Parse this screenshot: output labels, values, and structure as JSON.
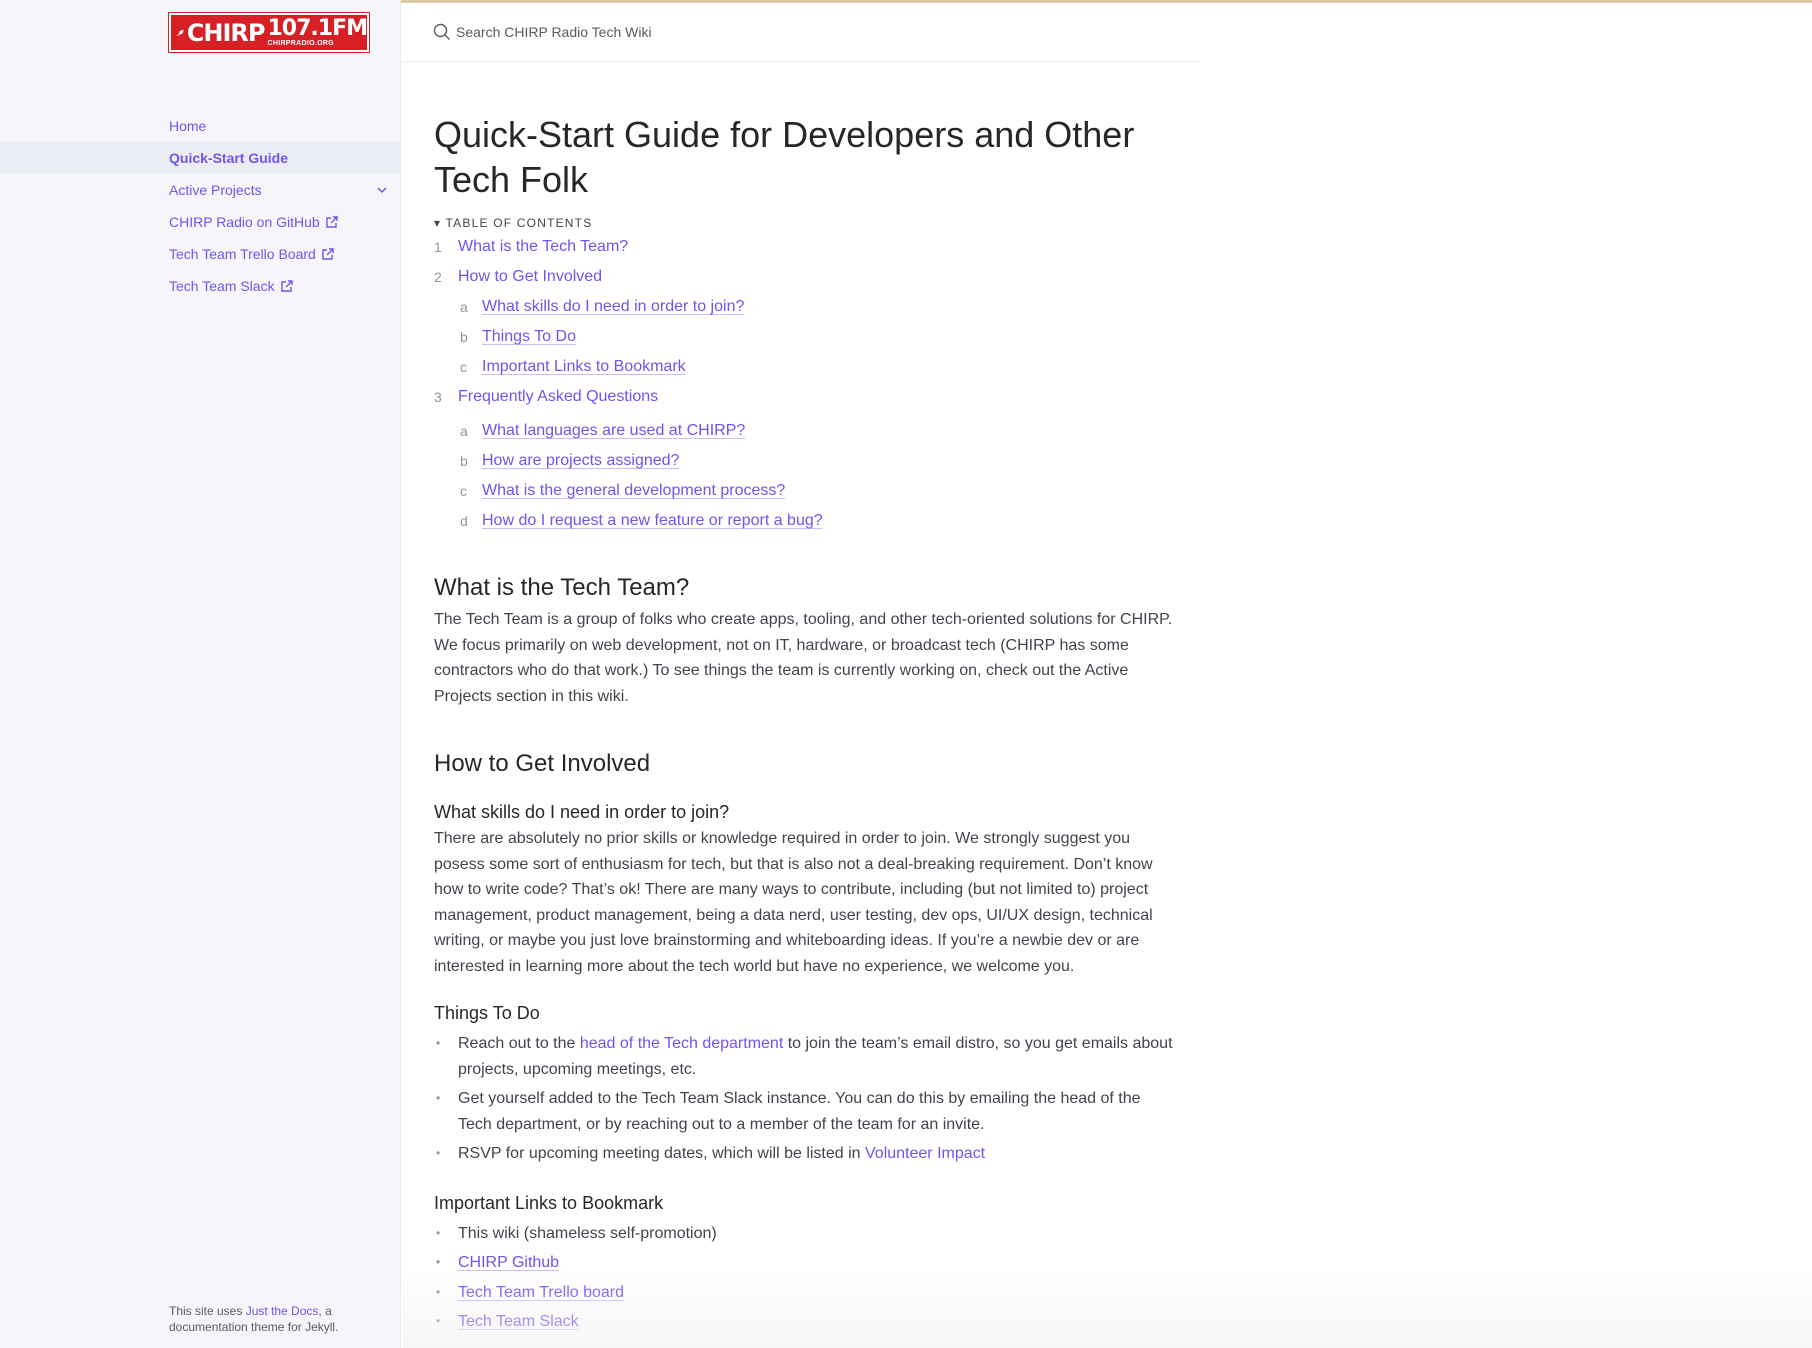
{
  "logo": {
    "name": "CHIRP",
    "frequency": "107.1FM",
    "url": "CHIRPRADIO.ORG"
  },
  "search": {
    "placeholder": "Search CHIRP Radio Tech Wiki"
  },
  "sidebar": {
    "items": [
      {
        "label": "Home"
      },
      {
        "label": "Quick-Start Guide",
        "active": true
      },
      {
        "label": "Active Projects"
      },
      {
        "label": "CHIRP Radio on GitHub"
      },
      {
        "label": "Tech Team Trello Board"
      },
      {
        "label": "Tech Team Slack"
      }
    ],
    "footer": {
      "prefix": "This site uses ",
      "link": "Just the Docs",
      "suffix": ", a documentation theme for Jekyll."
    }
  },
  "page": {
    "title": "Quick-Start Guide for Developers and Other Tech Folk",
    "toc_label": "▾ Table of contents",
    "toc": [
      {
        "num": "1",
        "label": "What is the Tech Team?"
      },
      {
        "num": "2",
        "label": "How to Get Involved",
        "children": [
          {
            "num": "a",
            "label": "What skills do I need in order to join?"
          },
          {
            "num": "b",
            "label": "Things To Do"
          },
          {
            "num": "c",
            "label": "Important Links to Bookmark"
          }
        ]
      },
      {
        "num": "3",
        "label": "Frequently Asked Questions",
        "children": [
          {
            "num": "a",
            "label": "What languages are used at CHIRP?"
          },
          {
            "num": "b",
            "label": "How are projects assigned?"
          },
          {
            "num": "c",
            "label": "What is the general development process?"
          },
          {
            "num": "d",
            "label": "How do I request a new feature or report a bug?"
          }
        ]
      }
    ],
    "s1": {
      "heading": "What is the Tech Team?",
      "body": "The Tech Team is a group of folks who create apps, tooling, and other tech-oriented solutions for CHIRP. We focus primarily on web development, not on IT, hardware, or broadcast tech (CHIRP has some contractors who do that work.) To see things the team is currently working on, check out the Active Projects section in this wiki."
    },
    "s2": {
      "heading": "How to Get Involved",
      "skills": {
        "heading": "What skills do I need in order to join?",
        "body": "There are absolutely no prior skills or knowledge required in order to join. We strongly suggest you posess some sort of enthusiasm for tech, but that is also not a deal-breaking requirement. Don’t know how to write code? That’s ok! There are many ways to contribute, including (but not limited to) project management, product management, being a data nerd, user testing, dev ops, UI/UX design, technical writing, or maybe you just love brainstorming and whiteboarding ideas. If you’re a newbie dev or are interested in learning more about the tech world but have no experience, we welcome you."
      },
      "todo": {
        "heading": "Things To Do",
        "item1_pre": "Reach out to the ",
        "item1_link": "head of the Tech department",
        "item1_post": " to join the team’s email distro, so you get emails about projects, upcoming meetings, etc.",
        "item2": "Get yourself added to the Tech Team Slack instance. You can do this by emailing the head of the Tech department, or by reaching out to a member of the team for an invite.",
        "item3_pre": "RSVP for upcoming meeting dates, which will be listed in ",
        "item3_link": "Volunteer Impact"
      },
      "links": {
        "heading": "Important Links to Bookmark",
        "item1": "This wiki (shameless self-promotion)",
        "item2": "CHIRP Github",
        "item3": "Tech Team Trello board",
        "item4": "Tech Team Slack"
      }
    }
  }
}
